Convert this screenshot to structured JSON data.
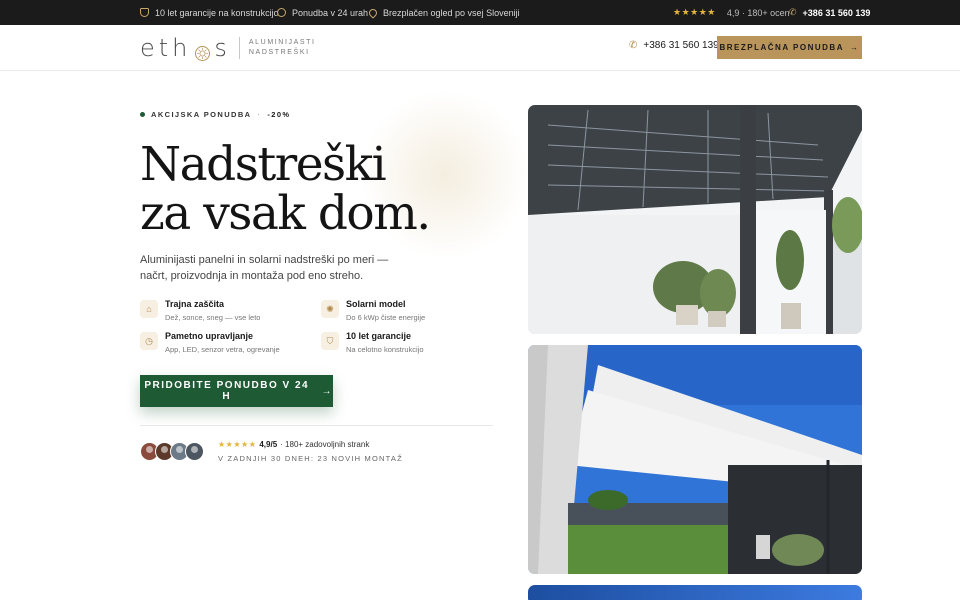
{
  "topbar": {
    "warranty": "10 let garancije na konstrukcijo",
    "offer_time": "Ponudba v 24 urah",
    "inspection": "Brezplačen ogled po vsej Sloveniji",
    "stars": "★★★★★",
    "rating": "4,9 · 180+ ocen",
    "phone": "+386 31 560 139"
  },
  "header": {
    "logo_left": "eth",
    "logo_right": "s",
    "tagline_1": "ALUMINIJASTI",
    "tagline_2": "NADSTREŠKI",
    "phone": "+386 31 560 139",
    "cta": "BREZPLAČNA PONUDBA",
    "cta_arrow": "→"
  },
  "hero": {
    "offer_label": "AKCIJSKA PONUDBA",
    "offer_sep": "·",
    "offer_discount": "-20%",
    "headline_1": "Nadstreški",
    "headline_2": "za vsak dom.",
    "lede": "Aluminijasti panelni in solarni nadstreški po meri — načrt, proizvodnja in montaža pod eno streho.",
    "features": [
      {
        "title": "Trajna zaščita",
        "sub": "Dež, sonce, sneg — vse leto",
        "icon": "home-icon"
      },
      {
        "title": "Solarni model",
        "sub": "Do 6 kWp čiste energije",
        "icon": "sun-icon"
      },
      {
        "title": "Pametno upravljanje",
        "sub": "App, LED, senzor vetra, ogrevanje",
        "icon": "clock-icon"
      },
      {
        "title": "10 let garancije",
        "sub": "Na celotno konstrukcijo",
        "icon": "shield-icon"
      }
    ],
    "cta": "PRIDOBITE PONUDBO V 24 H",
    "cta_arrow": "→",
    "stars": "★★★★★",
    "rating_score": "4,9/5",
    "rating_text": "· 180+ zadovoljnih strank",
    "recent": "V ZADNJIH 30 DNEH: 23 NOVIH MONTAŽ"
  },
  "colors": {
    "accent_gold": "#b9955b",
    "brand_green": "#1e5a34",
    "topbar_bg": "#1b1b1b"
  }
}
